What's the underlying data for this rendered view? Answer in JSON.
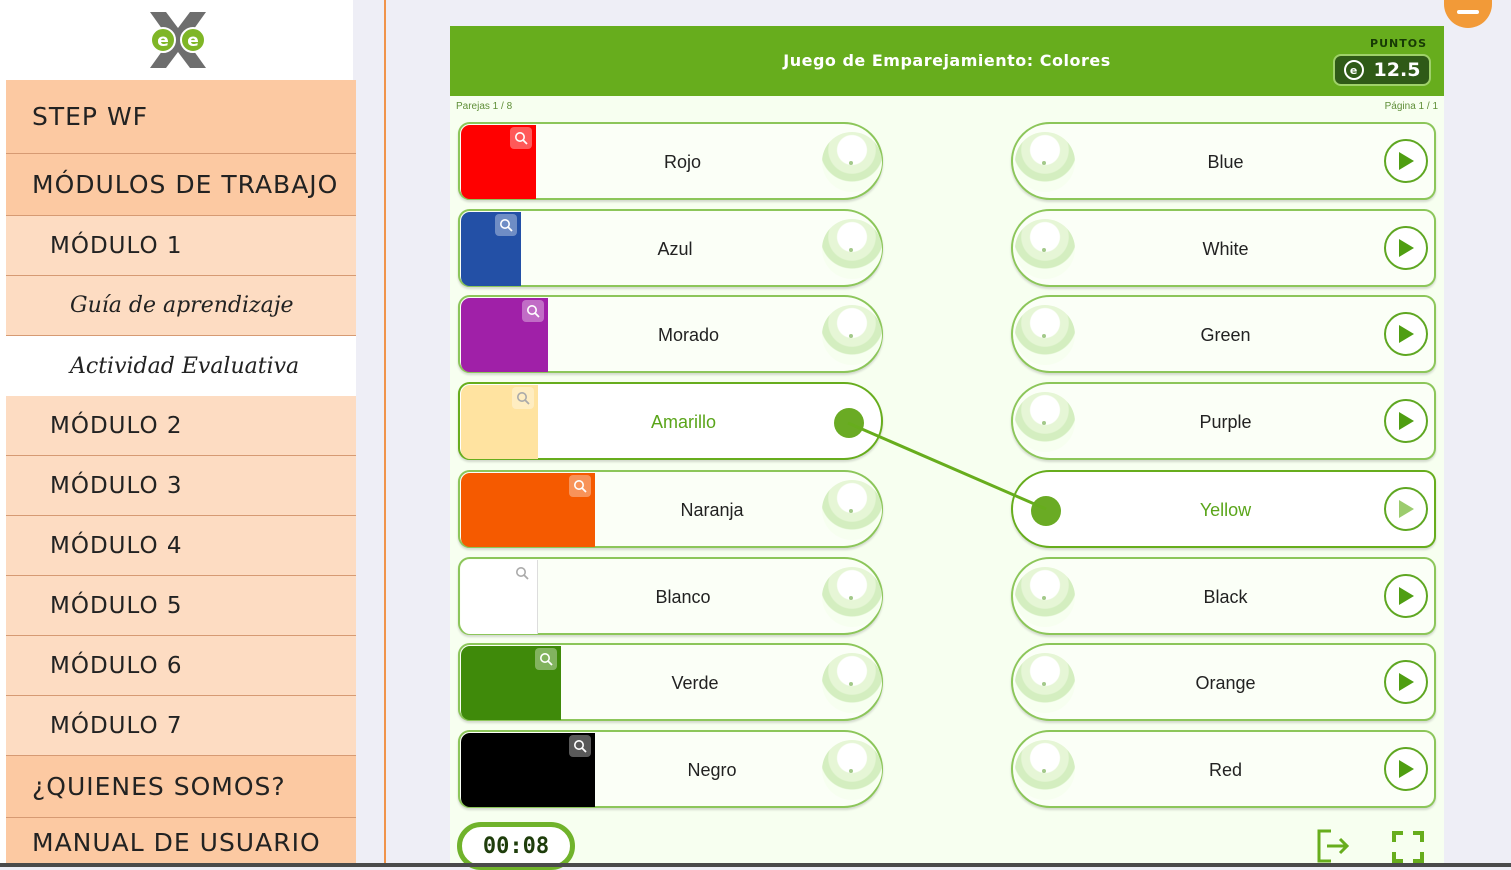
{
  "sidebar": {
    "logo_text": "eXe",
    "items": [
      {
        "label": "STEP WF",
        "level": "top"
      },
      {
        "label": "MÓDULOS DE TRABAJO",
        "level": "top"
      },
      {
        "label": "MÓDULO 1",
        "level": "sub"
      },
      {
        "label": "Guía de aprendizaje",
        "level": "sub2"
      },
      {
        "label": "Actividad Evaluativa",
        "level": "active"
      },
      {
        "label": "MÓDULO 2",
        "level": "sub"
      },
      {
        "label": "MÓDULO 3",
        "level": "sub"
      },
      {
        "label": "MÓDULO 4",
        "level": "sub"
      },
      {
        "label": "MÓDULO 5",
        "level": "sub"
      },
      {
        "label": "MÓDULO 6",
        "level": "sub"
      },
      {
        "label": "MÓDULO 7",
        "level": "sub"
      },
      {
        "label": "¿QUIENES SOMOS?",
        "level": "top"
      },
      {
        "label": "MANUAL DE USUARIO",
        "level": "top"
      }
    ]
  },
  "game": {
    "title": "Juego de Emparejamiento: Colores",
    "points_label": "PUNTOS",
    "score": "12.5",
    "coin_symbol": "e",
    "pairs_count": "Parejas 1 / 8",
    "page_count": "Página 1 / 1",
    "timer": "00:08",
    "accent_color": "#67ad1d"
  },
  "left_cards": [
    {
      "label": "Rojo",
      "color": "#ff0000",
      "zoom_icon": "magnifier-icon",
      "active": false
    },
    {
      "label": "Azul",
      "color": "#2350a6",
      "zoom_icon": "magnifier-icon",
      "active": false
    },
    {
      "label": "Morado",
      "color": "#a020a8",
      "zoom_icon": "magnifier-icon",
      "active": false
    },
    {
      "label": "Amarillo",
      "color": "#ffe3a0",
      "zoom_icon": "magnifier-icon",
      "active": true
    },
    {
      "label": "Naranja",
      "color": "#f55a00",
      "zoom_icon": "magnifier-icon",
      "active": false
    },
    {
      "label": "Blanco",
      "color": "#ffffff",
      "zoom_icon": "magnifier-icon",
      "active": false
    },
    {
      "label": "Verde",
      "color": "#3f8a0a",
      "zoom_icon": "magnifier-icon",
      "active": false
    },
    {
      "label": "Negro",
      "color": "#000000",
      "zoom_icon": "magnifier-icon",
      "active": false
    }
  ],
  "right_cards": [
    {
      "label": "Blue",
      "play_icon": "play-icon",
      "active": false
    },
    {
      "label": "White",
      "play_icon": "play-icon",
      "active": false
    },
    {
      "label": "Green",
      "play_icon": "play-icon",
      "active": false
    },
    {
      "label": "Purple",
      "play_icon": "play-icon",
      "active": false
    },
    {
      "label": "Yellow",
      "play_icon": "play-icon",
      "active": true
    },
    {
      "label": "Black",
      "play_icon": "play-icon",
      "active": false
    },
    {
      "label": "Orange",
      "play_icon": "play-icon",
      "active": false
    },
    {
      "label": "Red",
      "play_icon": "play-icon",
      "active": false
    }
  ],
  "connection": {
    "from": "Amarillo",
    "to": "Yellow"
  },
  "controls": {
    "exit_icon": "exit-icon",
    "fullscreen_icon": "fullscreen-icon",
    "minimize_icon": "minimize-icon"
  }
}
